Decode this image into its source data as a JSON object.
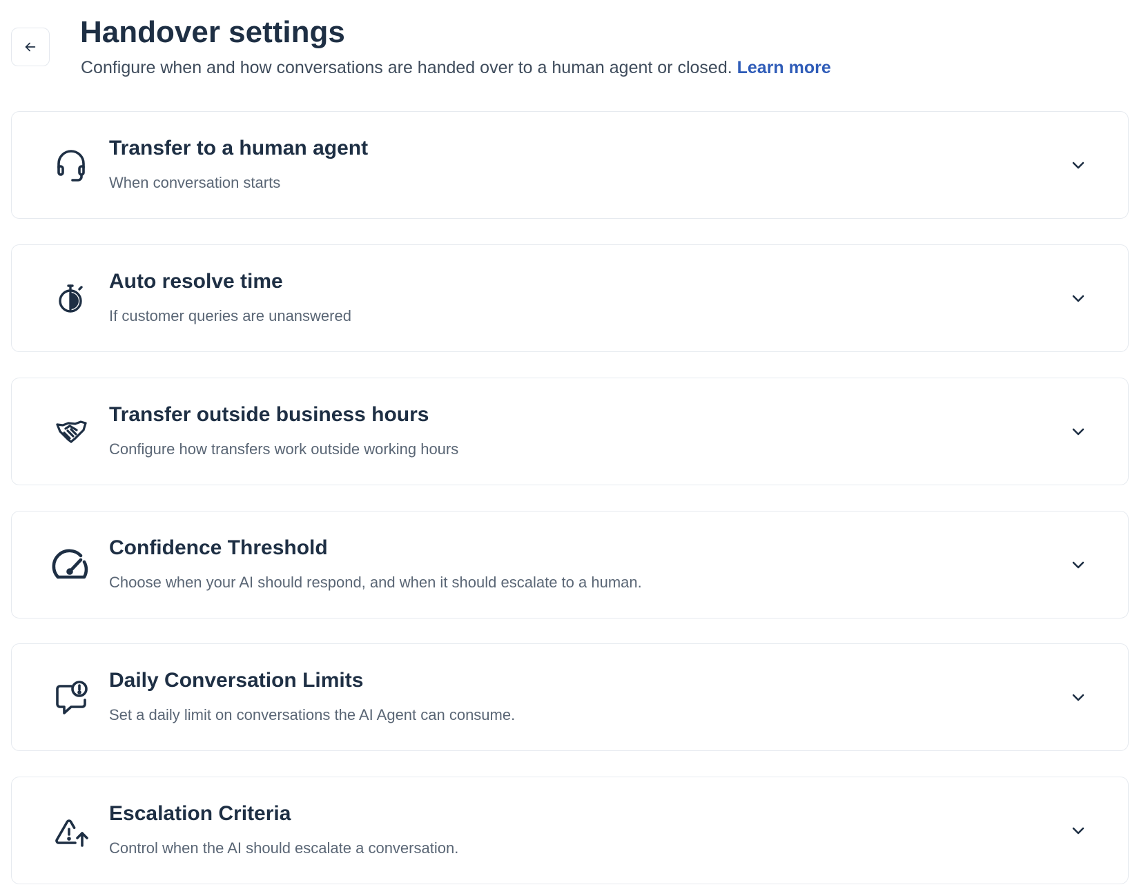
{
  "header": {
    "back_icon": "arrow-left-icon",
    "title": "Handover settings",
    "subtitle": "Configure when and how conversations are handed over to a human agent or closed.",
    "learn_more": "Learn more"
  },
  "colors": {
    "heading": "#1e2f44",
    "body_text": "#5a6675",
    "link": "#2f5cb8",
    "card_border": "#e6eaef"
  },
  "sections": [
    {
      "icon": "headset-icon",
      "title": "Transfer to a human agent",
      "description": "When conversation starts",
      "expanded": false
    },
    {
      "icon": "stopwatch-icon",
      "title": "Auto resolve time",
      "description": "If customer queries are unanswered",
      "expanded": false
    },
    {
      "icon": "handshake-icon",
      "title": "Transfer outside business hours",
      "description": "Configure how transfers work outside working hours",
      "expanded": false
    },
    {
      "icon": "gauge-icon",
      "title": "Confidence Threshold",
      "description": "Choose when your AI should respond, and when it should escalate to a human.",
      "expanded": false
    },
    {
      "icon": "chat-alert-icon",
      "title": "Daily Conversation Limits",
      "description": "Set a daily limit on conversations the AI Agent can consume.",
      "expanded": false
    },
    {
      "icon": "warning-escalate-icon",
      "title": "Escalation Criteria",
      "description": "Control when the AI should escalate a conversation.",
      "expanded": false
    }
  ]
}
